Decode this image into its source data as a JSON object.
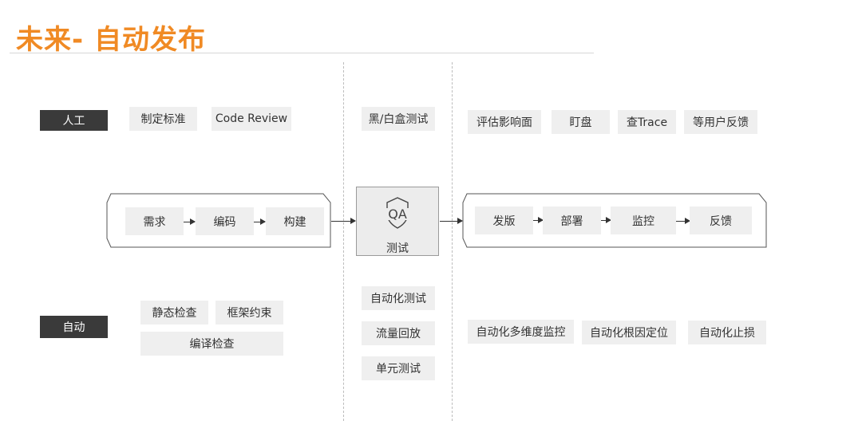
{
  "title": "未来- 自动发布",
  "rows": {
    "manual": {
      "label": "人工",
      "left": [
        "制定标准",
        "Code Review"
      ],
      "middle": [
        "黑/白盒测试"
      ],
      "right": [
        "评估影响面",
        "盯盘",
        "查Trace",
        "等用户反馈"
      ]
    },
    "auto": {
      "label": "自动",
      "left": [
        "静态检查",
        "框架约束",
        "编译检查"
      ],
      "middle": [
        "自动化测试",
        "流量回放",
        "单元测试"
      ],
      "right": [
        "自动化多维度监控",
        "自动化根因定位",
        "自动化止损"
      ]
    }
  },
  "pipeline": {
    "dev": [
      "需求",
      "编码",
      "构建"
    ],
    "qa": {
      "icon": "qa-shield-icon",
      "label": "测试"
    },
    "ops": [
      "发版",
      "部署",
      "监控",
      "反馈"
    ]
  },
  "colors": {
    "title": "#f08a24",
    "tag": "#3a3a3a",
    "box": "#efefef"
  }
}
